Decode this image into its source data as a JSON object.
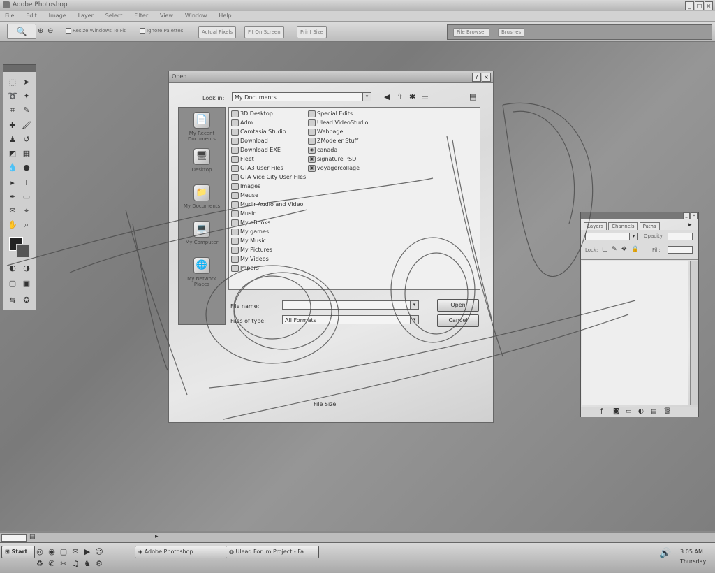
{
  "app": {
    "title": "Adobe Photoshop"
  },
  "menu": [
    "File",
    "Edit",
    "Image",
    "Layer",
    "Select",
    "Filter",
    "View",
    "Window",
    "Help"
  ],
  "options_bar": {
    "resize_windows": "Resize Windows To Fit",
    "ignore_palettes": "Ignore Palettes",
    "actual_pixels": "Actual Pixels",
    "fit_on_screen": "Fit On Screen",
    "print_size": "Print Size",
    "well_tabs": [
      "File Browser",
      "Brushes"
    ]
  },
  "dialog": {
    "title": "Open",
    "look_in_label": "Look in:",
    "look_in_value": "My Documents",
    "places": [
      "My Recent Documents",
      "Desktop",
      "My Documents",
      "My Computer",
      "My Network Places"
    ],
    "files_col1": [
      "3D Desktop",
      "Adm",
      "Camtasia Studio",
      "Download",
      "Download EXE",
      "Fleet",
      "GTA3 User Files",
      "GTA Vice City User Files",
      "Images",
      "Meuse",
      "Mudir Audio and Video",
      "Music",
      "My eBooks",
      "My games",
      "My Music",
      "My Pictures",
      "My Videos",
      "Papers"
    ],
    "files_col2": [
      "Special Edits",
      "Ulead VideoStudio",
      "Webpage",
      "ZModeler Stuff",
      "canada",
      "signature PSD",
      "voyagercollage"
    ],
    "file_name_label": "File name:",
    "file_name_value": "",
    "files_of_type_label": "Files of type:",
    "files_of_type_value": "All Formats",
    "open_button": "Open",
    "cancel_button": "Cancel",
    "file_size": "File Size"
  },
  "layers_palette": {
    "tabs": [
      "Layers",
      "Channels",
      "Paths"
    ],
    "opacity_label": "Opacity:",
    "lock_label": "Lock:",
    "fill_label": "Fill:"
  },
  "taskbar": {
    "start": "Start",
    "tasks": [
      "Adobe Photoshop",
      "Ulead Forum Project - Fa..."
    ],
    "time": "3:05 AM",
    "day": "Thursday"
  },
  "colors": {
    "desktop": "#8a8a8a",
    "panel": "#d4d4d4",
    "ink": "#333333"
  }
}
